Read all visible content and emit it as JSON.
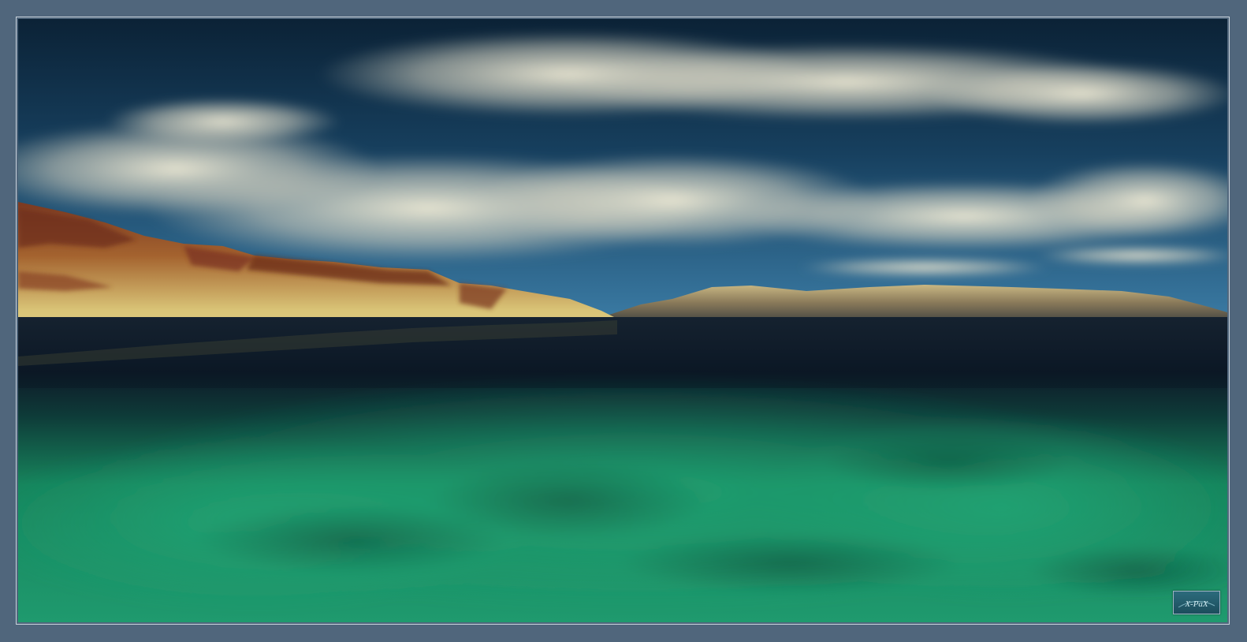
{
  "artwork": {
    "signature": "X-PaX",
    "colors": {
      "frame": "#50667c",
      "sky_top": "#0c2438",
      "sky_horizon": "#2f6a92",
      "cloud": "#e8e4cf",
      "cliff_sunlit": "#d8c373",
      "cliff_shadow": "#6e2f1c",
      "water_dark": "#0b1622",
      "water_shallow": "#1f9a6a"
    }
  }
}
